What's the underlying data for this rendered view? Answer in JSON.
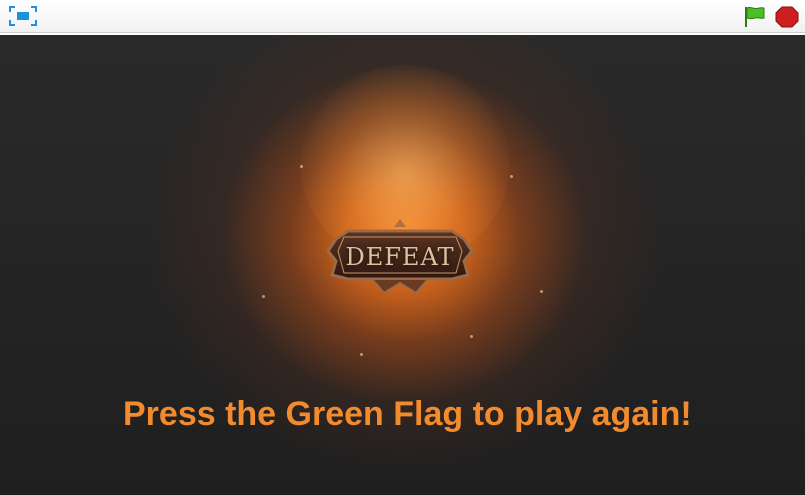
{
  "toolbar": {
    "fullscreen_icon": "fullscreen-icon",
    "flag_icon": "green-flag-icon",
    "stop_icon": "stop-sign-icon",
    "colors": {
      "flag": "#4cbf25",
      "stop": "#cc1f1f",
      "fullscreen": "#1f8fe0"
    }
  },
  "stage": {
    "banner_text": "DEFEAT",
    "message": "Press the Green Flag to play again!",
    "colors": {
      "message": "#f28a2e",
      "glow": "#ff8c28",
      "background": "#262626"
    }
  }
}
